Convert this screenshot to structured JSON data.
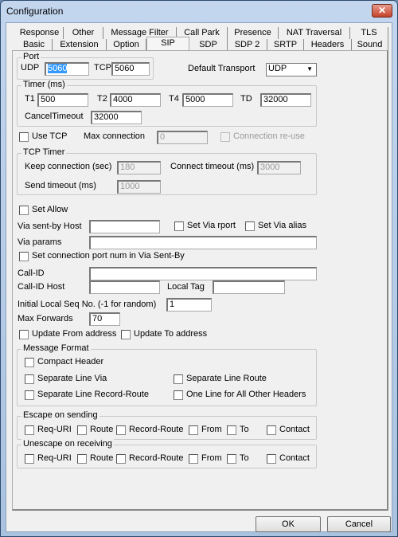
{
  "window": {
    "title": "Configuration",
    "close_icon": "close-icon"
  },
  "tabs_back": [
    "Response",
    "Other",
    "Message Filter",
    "Call Park",
    "Presence",
    "NAT Traversal",
    "TLS"
  ],
  "tabs_front": [
    "Basic",
    "Extension",
    "Option",
    "SIP",
    "SDP",
    "SDP 2",
    "SRTP",
    "Headers",
    "Sound"
  ],
  "active_tab": "SIP",
  "port": {
    "label": "Port",
    "udp_label": "UDP",
    "udp": "5060",
    "tcp_label": "TCP",
    "tcp": "5060"
  },
  "transport": {
    "label": "Default Transport",
    "value": "UDP"
  },
  "timer": {
    "label": "Timer (ms)",
    "t1_label": "T1",
    "t1": "500",
    "t2_label": "T2",
    "t2": "4000",
    "t4_label": "T4",
    "t4": "5000",
    "td_label": "TD",
    "td": "32000",
    "cancel_label": "CancelTimeout",
    "cancel": "32000"
  },
  "tcp": {
    "use_label": "Use TCP",
    "max_label": "Max connection",
    "max": "0",
    "reuse_label": "Connection re-use"
  },
  "tcp_timer": {
    "label": "TCP Timer",
    "keep_label": "Keep connection (sec)",
    "keep": "180",
    "connect_label": "Connect timeout (ms)",
    "connect": "3000",
    "send_label": "Send timeout (ms)",
    "send": "1000"
  },
  "sip": {
    "set_allow": "Set Allow",
    "via_host_label": "Via sent-by Host",
    "via_host": "",
    "rport": "Set Via rport",
    "alias": "Set Via alias",
    "via_params_label": "Via params",
    "via_params": "",
    "conn_port": "Set connection port num in Via Sent-By",
    "callid_label": "Call-ID",
    "callid": "",
    "callid_host_label": "Call-ID Host",
    "callid_host": "",
    "local_tag_label": "Local Tag",
    "local_tag": "",
    "seq_label": "Initial Local Seq No. (-1 for random)",
    "seq": "1",
    "maxfwd_label": "Max Forwards",
    "maxfwd": "70",
    "upd_from": "Update From address",
    "upd_to": "Update To address"
  },
  "msg_format": {
    "label": "Message Format",
    "compact": "Compact Header",
    "sep_via": "Separate Line Via",
    "sep_route": "Separate Line Route",
    "sep_rr": "Separate Line Record-Route",
    "one_line": "One Line for All Other Headers"
  },
  "escape": {
    "label": "Escape on sending",
    "items": [
      "Req-URI",
      "Route",
      "Record-Route",
      "From",
      "To",
      "Contact"
    ]
  },
  "unescape": {
    "label": "Unescape on receiving",
    "items": [
      "Req-URI",
      "Route",
      "Record-Route",
      "From",
      "To",
      "Contact"
    ]
  },
  "buttons": {
    "ok": "OK",
    "cancel": "Cancel"
  }
}
